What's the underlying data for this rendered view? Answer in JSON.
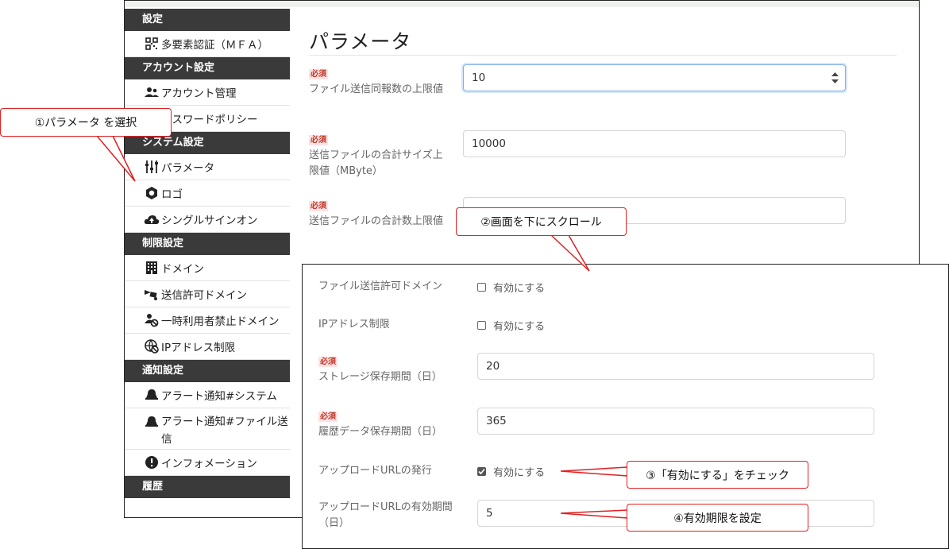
{
  "sidebar": {
    "sections": [
      {
        "label": "設定",
        "items": [
          {
            "label": "多要素認証（ＭＦＡ）",
            "icon": "qr-code-icon"
          }
        ]
      },
      {
        "label": "アカウント設定",
        "items": [
          {
            "label": "アカウント管理",
            "icon": "users-icon"
          },
          {
            "label": "パスワードポリシー",
            "icon": "key-icon"
          }
        ]
      },
      {
        "label": "システム設定",
        "items": [
          {
            "label": "パラメータ",
            "icon": "sliders-icon"
          },
          {
            "label": "ロゴ",
            "icon": "hexagon-icon"
          },
          {
            "label": "シングルサインオン",
            "icon": "cloud-icon"
          }
        ]
      },
      {
        "label": "制限設定",
        "items": [
          {
            "label": "ドメイン",
            "icon": "building-icon"
          },
          {
            "label": "送信許可ドメイン",
            "icon": "truck-icon"
          },
          {
            "label": "一時利用者禁止ドメイン",
            "icon": "user-ban-icon"
          },
          {
            "label": "IPアドレス制限",
            "icon": "globe-ban-icon"
          }
        ]
      },
      {
        "label": "通知設定",
        "items": [
          {
            "label": "アラート通知#システム",
            "icon": "bell-icon"
          },
          {
            "label": "アラート通知#ファイル送信",
            "icon": "bell-icon"
          },
          {
            "label": "インフォメーション",
            "icon": "info-icon"
          }
        ]
      },
      {
        "label": "履歴",
        "items": []
      }
    ]
  },
  "main": {
    "title": "パラメータ",
    "required_badge": "必須",
    "fields": [
      {
        "label": "ファイル送信同報数の上限値",
        "value": "10"
      },
      {
        "label": "送信ファイルの合計サイズ上限値（MByte）",
        "value": "10000"
      },
      {
        "label": "送信ファイルの合計数上限値",
        "value": ""
      }
    ]
  },
  "lower": {
    "checkbox_text": "有効にする",
    "rows": [
      {
        "label": "ファイル送信許可ドメイン",
        "checked": false
      },
      {
        "label": "IPアドレス制限",
        "checked": false
      },
      {
        "label": "ストレージ保存期間（日）",
        "value": "20"
      },
      {
        "label": "履歴データ保存期間（日）",
        "value": "365"
      },
      {
        "label": "アップロードURLの発行",
        "checked": true
      },
      {
        "label": "アップロードURLの有効期間（日）",
        "value": "5"
      }
    ]
  },
  "callouts": {
    "c1": "①パラメータ を選択",
    "c2": "②画面を下にスクロール",
    "c3": "③「有効にする」をチェック",
    "c4": "④有効期限を設定"
  },
  "colors": {
    "callout_border": "#e02020",
    "sidebar_header": "#3a3a3a",
    "required": "#c0392b"
  }
}
